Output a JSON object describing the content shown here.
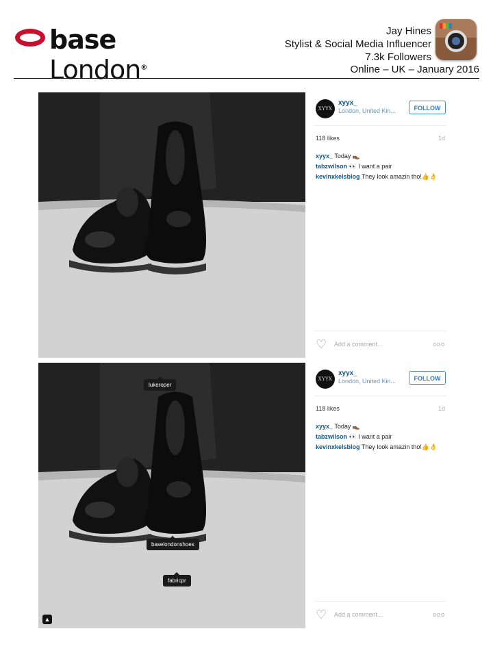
{
  "header": {
    "logo_brand": "base",
    "logo_city": "London",
    "logo_mark": "®",
    "name": "Jay Hines",
    "role": "Stylist & Social Media Influencer",
    "followers": "7.3k Followers",
    "coverage": "Online – UK – January 2016",
    "instagram_icon": "instagram-camera-icon"
  },
  "posts": [
    {
      "avatar_text": "XYYX",
      "username": "xyyx_",
      "location": "London, United Kin...",
      "follow_label": "FOLLOW",
      "likes": "118 likes",
      "age": "1d",
      "comments": [
        {
          "user": "xyyx_",
          "text": " Today 👞"
        },
        {
          "user": "tabzwilson",
          "text": " 👀 I want a pair"
        },
        {
          "user": "kevinxkelsblog",
          "text": " They look amazin tho!👍👌"
        }
      ],
      "add_comment_placeholder": "Add a comment...",
      "more_label": "ooo"
    },
    {
      "avatar_text": "XYYX",
      "username": "xyyx_",
      "location": "London, United Kin...",
      "follow_label": "FOLLOW",
      "likes": "118 likes",
      "age": "1d",
      "comments": [
        {
          "user": "xyyx_",
          "text": " Today 👞"
        },
        {
          "user": "tabzwilson",
          "text": " 👀 I want a pair"
        },
        {
          "user": "kevinxkelsblog",
          "text": " They look amazin tho!👍👌"
        }
      ],
      "add_comment_placeholder": "Add a comment...",
      "more_label": "ooo",
      "photo_tags": [
        "lukeroper",
        "baselondonshoes",
        "fabricpr"
      ]
    }
  ],
  "colors": {
    "logo_ring": "#c8102e",
    "link_blue": "#125688",
    "follow_blue": "#3b7cb8"
  }
}
